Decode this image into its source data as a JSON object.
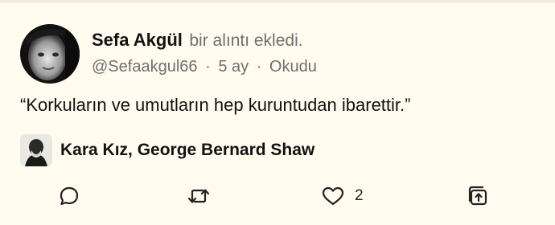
{
  "post": {
    "user_name": "Sefa Akgül",
    "action_text": "bir alıntı ekledi.",
    "handle": "@Sefaakgul66",
    "time_ago": "5 ay",
    "status": "Okudu",
    "separator": "·",
    "quote": "“Korkuların ve umutların hep kuruntudan ibarettir.”"
  },
  "book": {
    "title": "Kara Kız, George Bernard Shaw"
  },
  "actions": {
    "like_count": "2"
  },
  "colors": {
    "background": "#FFFCEF",
    "text": "#121212",
    "muted": "#6f6f6f"
  },
  "icons": [
    "comment-icon",
    "repost-icon",
    "heart-icon",
    "share-icon"
  ]
}
